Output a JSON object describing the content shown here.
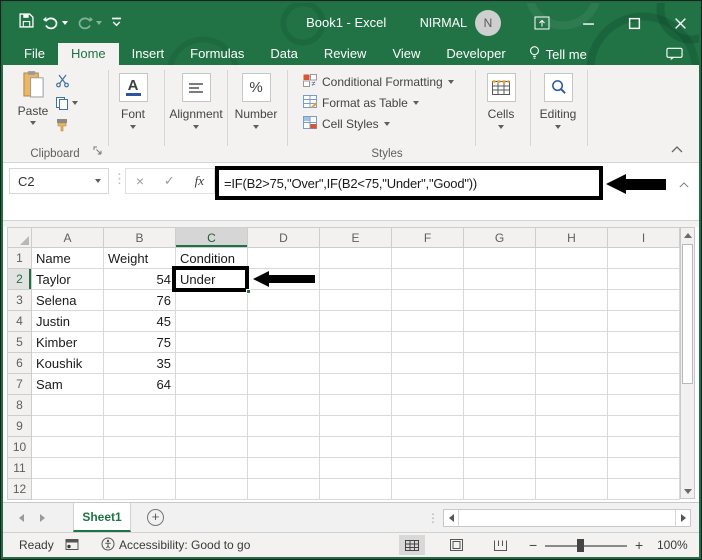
{
  "window": {
    "title": "Book1 - Excel",
    "user_name": "NIRMAL",
    "avatar_initial": "N"
  },
  "tabs": {
    "items": [
      "File",
      "Home",
      "Insert",
      "Formulas",
      "Data",
      "Review",
      "View",
      "Developer"
    ],
    "active": "Home",
    "tell_me": "Tell me"
  },
  "ribbon": {
    "paste": "Paste",
    "font": "Font",
    "alignment": "Alignment",
    "number": "Number",
    "styles_items": [
      "Conditional Formatting",
      "Format as Table",
      "Cell Styles"
    ],
    "cells": "Cells",
    "editing": "Editing",
    "group_labels": {
      "clipboard": "Clipboard",
      "styles": "Styles"
    }
  },
  "formula_bar": {
    "name_box": "C2",
    "cancel": "×",
    "enter": "✓",
    "fx": "fx",
    "formula": "=IF(B2>75,\"Over\",IF(B2<75,\"Under\",\"Good\"))"
  },
  "grid": {
    "columns": [
      "A",
      "B",
      "C",
      "D",
      "E",
      "F",
      "G",
      "H",
      "I"
    ],
    "row_count": 12,
    "selected_cell": "C2",
    "selected_column": "C",
    "selected_row": 2,
    "cells": [
      {
        "r": 1,
        "c": "A",
        "v": "Name"
      },
      {
        "r": 1,
        "c": "B",
        "v": "Weight"
      },
      {
        "r": 1,
        "c": "C",
        "v": "Condition"
      },
      {
        "r": 2,
        "c": "A",
        "v": "Taylor"
      },
      {
        "r": 2,
        "c": "B",
        "v": "54"
      },
      {
        "r": 2,
        "c": "C",
        "v": "Under"
      },
      {
        "r": 3,
        "c": "A",
        "v": "Selena"
      },
      {
        "r": 3,
        "c": "B",
        "v": "76"
      },
      {
        "r": 4,
        "c": "A",
        "v": "Justin"
      },
      {
        "r": 4,
        "c": "B",
        "v": "45"
      },
      {
        "r": 5,
        "c": "A",
        "v": "Kimber"
      },
      {
        "r": 5,
        "c": "B",
        "v": "75"
      },
      {
        "r": 6,
        "c": "A",
        "v": "Koushik"
      },
      {
        "r": 6,
        "c": "B",
        "v": "35"
      },
      {
        "r": 7,
        "c": "A",
        "v": "Sam"
      },
      {
        "r": 7,
        "c": "B",
        "v": "64"
      }
    ]
  },
  "sheet_bar": {
    "sheets": [
      "Sheet1"
    ],
    "active": "Sheet1"
  },
  "status_bar": {
    "mode": "Ready",
    "accessibility": "Accessibility: Good to go",
    "zoom_level": "100%"
  },
  "annotations": [
    "formula-highlight-box",
    "formula-arrow",
    "c2-highlight-box",
    "c2-arrow"
  ],
  "colors": {
    "excel_green": "#217346",
    "annotation_black": "#000000"
  }
}
